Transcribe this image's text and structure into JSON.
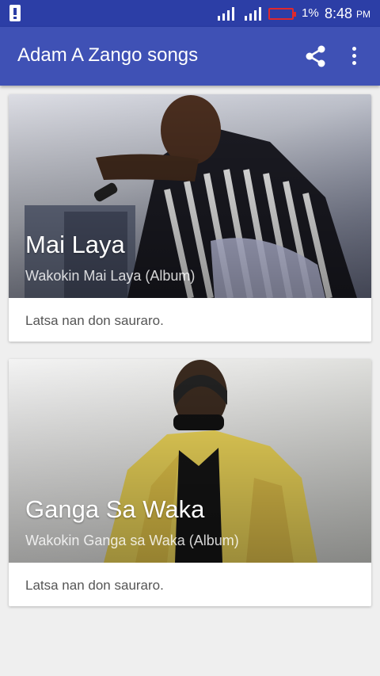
{
  "status_bar": {
    "battery_percent": "1%",
    "time": "8:48",
    "ampm": "PM",
    "icons": [
      "warning-icon",
      "signal-icon",
      "signal-icon",
      "battery-icon"
    ]
  },
  "app_bar": {
    "title": "Adam A Zango songs",
    "background": "#3f51b5",
    "actions": [
      "share-icon",
      "more-vert-icon"
    ]
  },
  "cards": [
    {
      "title": "Mai Laya",
      "subtitle": "Wakokin Mai Laya (Album)",
      "description": "Latsa nan don sauraro."
    },
    {
      "title": "Ganga Sa Waka",
      "subtitle": "Wakokin Ganga sa Waka (Album)",
      "description": "Latsa nan don sauraro."
    }
  ]
}
